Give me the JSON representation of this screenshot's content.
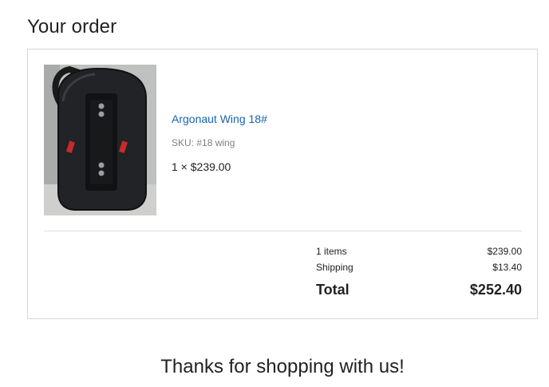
{
  "heading": "Your order",
  "product": {
    "name": "Argonaut Wing 18#",
    "sku": "SKU: #18 wing",
    "quantity_price": "1 × $239.00",
    "image_icon": "product-photo-bcd-wing"
  },
  "summary": {
    "items_label": "1 items",
    "items_value": "$239.00",
    "shipping_label": "Shipping",
    "shipping_value": "$13.40",
    "total_label": "Total",
    "total_value": "$252.40"
  },
  "thanks": "Thanks for shopping with us!",
  "colors": {
    "link": "#1565b0",
    "border": "#d7d7d7",
    "muted": "#808080"
  }
}
